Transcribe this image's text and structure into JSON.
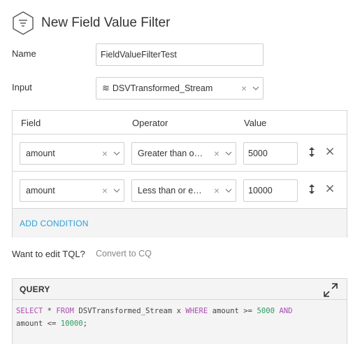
{
  "header": {
    "title": "New Field Value Filter",
    "icon": "filter-icon"
  },
  "name_field": {
    "label": "Name",
    "value": "FieldValueFilterTest"
  },
  "input_field": {
    "label": "Input",
    "value": "DSVTransformed_Stream",
    "icon": "stream-icon",
    "icon_glyph": "≋"
  },
  "conditions": {
    "columns": [
      "Field",
      "Operator",
      "Value"
    ],
    "rows": [
      {
        "field": "amount",
        "operator": "Greater than o…",
        "value": "5000"
      },
      {
        "field": "amount",
        "operator": "Less than or e…",
        "value": "10000"
      }
    ],
    "add_label": "ADD CONDITION"
  },
  "tql": {
    "label": "Want to edit TQL?",
    "link": "Convert to CQ"
  },
  "query": {
    "title": "QUERY",
    "tokens": {
      "select": "SELECT",
      "star": " * ",
      "from": "FROM",
      "from_rest": " DSVTransformed_Stream x ",
      "where": "WHERE",
      "where_rest": " amount >= ",
      "num1": "5000",
      "and_pre": " ",
      "and": "AND",
      "line2": "amount <= ",
      "num2": "10000",
      "end": ";"
    }
  },
  "colors": {
    "link": "#2a9fd8",
    "keyword": "#a84fb0",
    "number": "#2e9b62",
    "muted_link": "#888888"
  }
}
